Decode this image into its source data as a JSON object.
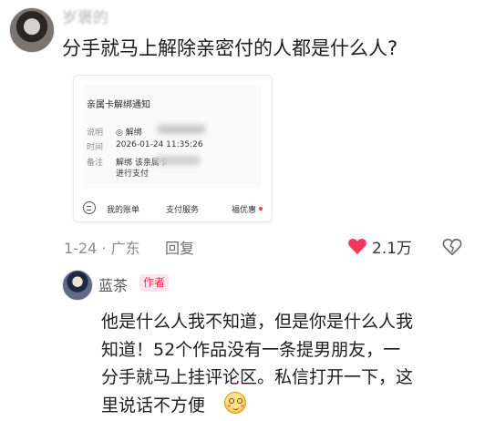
{
  "post": {
    "username": "岁褒的",
    "text": "分手就马上解除亲密付的人都是什么人?"
  },
  "card": {
    "title": "亲属卡解绑通知",
    "rows": [
      {
        "key": "说明",
        "value": "◎ 解绑"
      },
      {
        "key": "时间",
        "value": "2026-01-24 11:35:26"
      },
      {
        "key": "备注",
        "value": "解绑                 该亲属卡"
      },
      {
        "key": "",
        "value": "进行支付"
      }
    ],
    "nav": [
      "我的账单",
      "支付服务",
      "福优惠"
    ],
    "nav_icon": "wallet-icon"
  },
  "meta": {
    "date_location": "1-24 · 广东",
    "reply_label": "回复",
    "likes": "2.1万",
    "like_color": "#f5365c"
  },
  "reply": {
    "author": "蓝茶",
    "badge": "作者",
    "lines": [
      "他是什么人我不知道，但是你是什么人我",
      "知道！52个作品没有一条提男朋友，一",
      "分手就马上挂评论区。私信打开一下，这",
      "里说话不方便"
    ],
    "emoji": "blushing-smile-emoji"
  }
}
